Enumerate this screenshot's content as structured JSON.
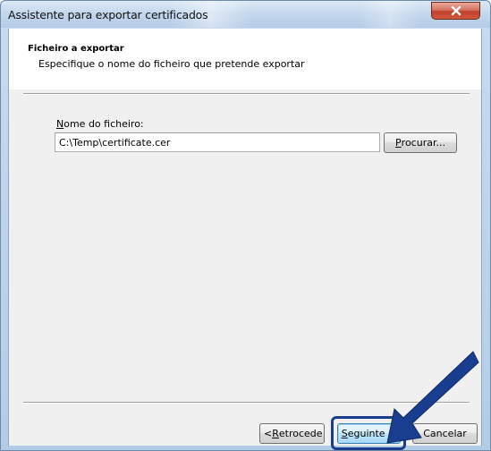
{
  "window": {
    "title": "Assistente para exportar certificados"
  },
  "header": {
    "title": "Ficheiro a exportar",
    "subtitle": "Especifique o nome do ficheiro que pretende exportar"
  },
  "form": {
    "filename_label_mnemonic": "N",
    "filename_label_rest": "ome do ficheiro:",
    "filename_value": "C:\\Temp\\certificate.cer",
    "browse_mnemonic": "P",
    "browse_rest": "rocurar..."
  },
  "footer": {
    "back_prefix": "< ",
    "back_mnemonic": "R",
    "back_rest": "etrocede",
    "next_mnemonic": "S",
    "next_rest": "eguinte >",
    "cancel_label": "Cancelar"
  },
  "icons": {
    "close": "close-icon",
    "arrow": "pointer-arrow-icon"
  },
  "colors": {
    "accent": "#1a3e8f",
    "close_button": "#c1402a"
  }
}
